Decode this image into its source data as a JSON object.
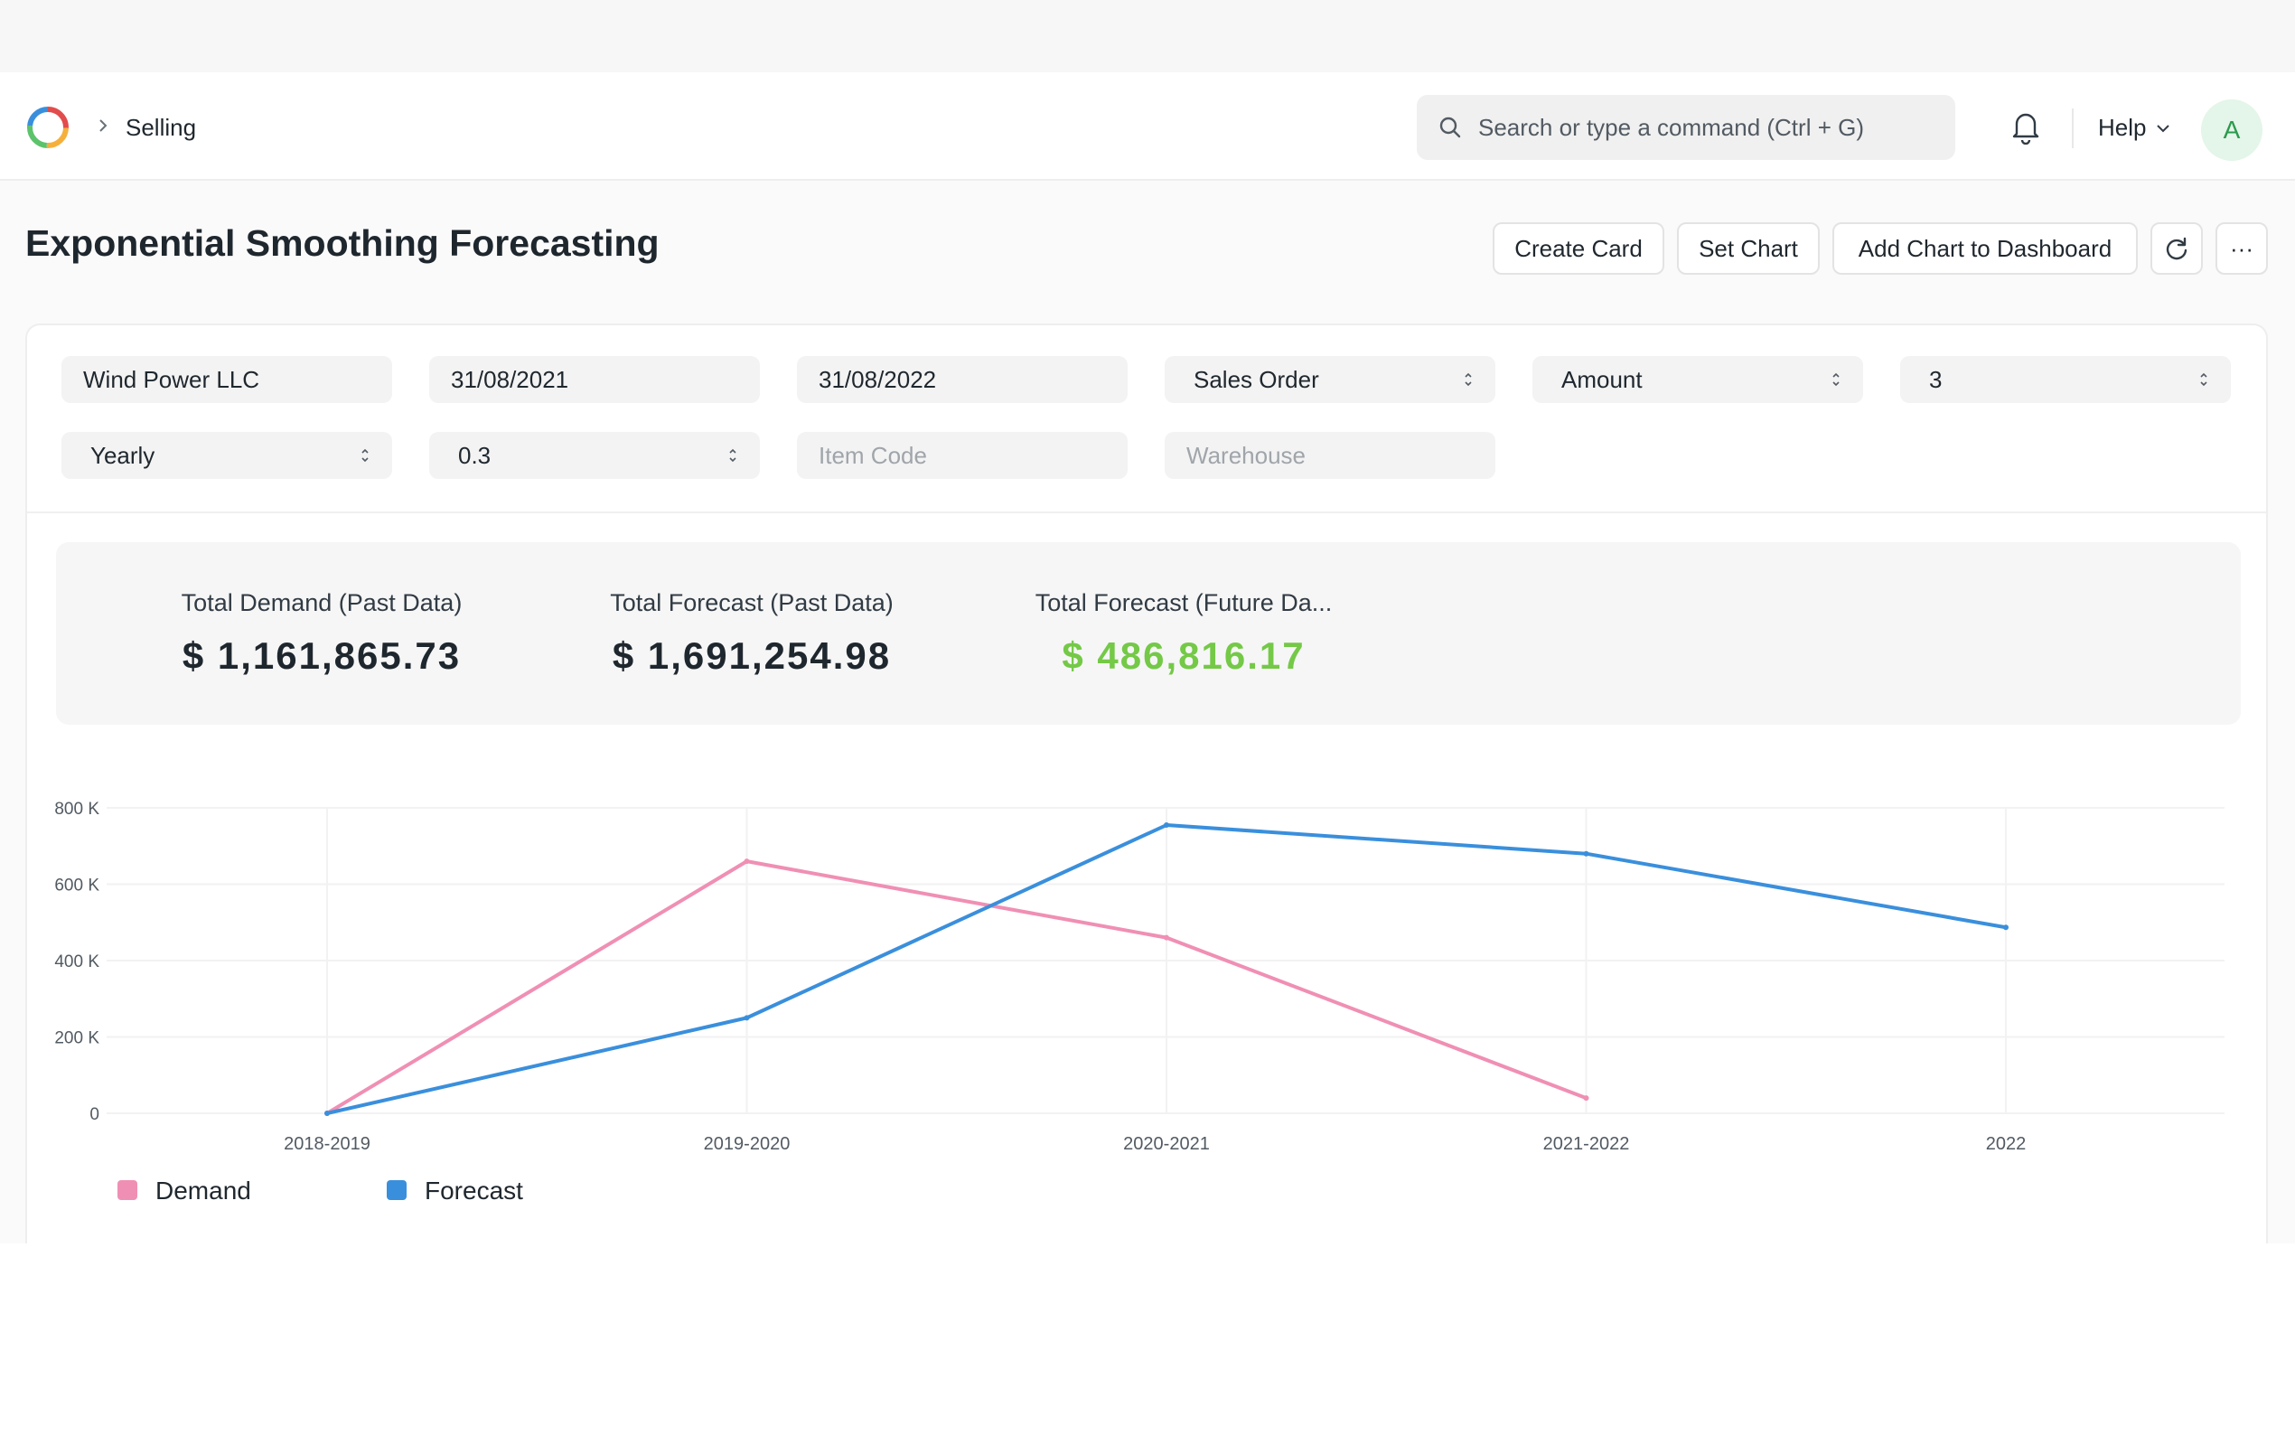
{
  "navbar": {
    "breadcrumb": "Selling",
    "search_placeholder": "Search or type a command (Ctrl + G)",
    "help_label": "Help",
    "avatar_initial": "A"
  },
  "page": {
    "title": "Exponential Smoothing Forecasting",
    "buttons": {
      "create_card": "Create Card",
      "set_chart": "Set Chart",
      "add_chart": "Add Chart to Dashboard",
      "more": "···"
    }
  },
  "filters": {
    "company": "Wind Power LLC",
    "from_date": "31/08/2021",
    "to_date": "31/08/2022",
    "based_on_document": "Sales Order",
    "based_on_field": "Amount",
    "no_of_years": "3",
    "periodicity": "Yearly",
    "smoothing_constant": "0.3",
    "item_code_placeholder": "Item Code",
    "warehouse_placeholder": "Warehouse"
  },
  "summary": {
    "demand_label": "Total Demand (Past Data)",
    "demand_value": "$ 1,161,865.73",
    "forecast_past_label": "Total Forecast (Past Data)",
    "forecast_past_value": "$ 1,691,254.98",
    "forecast_future_label": "Total Forecast (Future Da...",
    "forecast_future_value": "$ 486,816.17",
    "forecast_future_color": "#74c947"
  },
  "chart_data": {
    "type": "line",
    "categories": [
      "2018-2019",
      "2019-2020",
      "2020-2021",
      "2021-2022",
      "2022"
    ],
    "y_ticks": [
      "0",
      "200 K",
      "400 K",
      "600 K",
      "800 K"
    ],
    "ylim": [
      0,
      800000
    ],
    "grid": true,
    "legend_position": "bottom-left",
    "series": [
      {
        "name": "Demand",
        "color": "#f08fb4",
        "values": [
          0,
          660000,
          460000,
          40000,
          null
        ]
      },
      {
        "name": "Forecast",
        "color": "#3a8fdc",
        "values": [
          0,
          250000,
          755000,
          680000,
          487000
        ]
      }
    ]
  }
}
